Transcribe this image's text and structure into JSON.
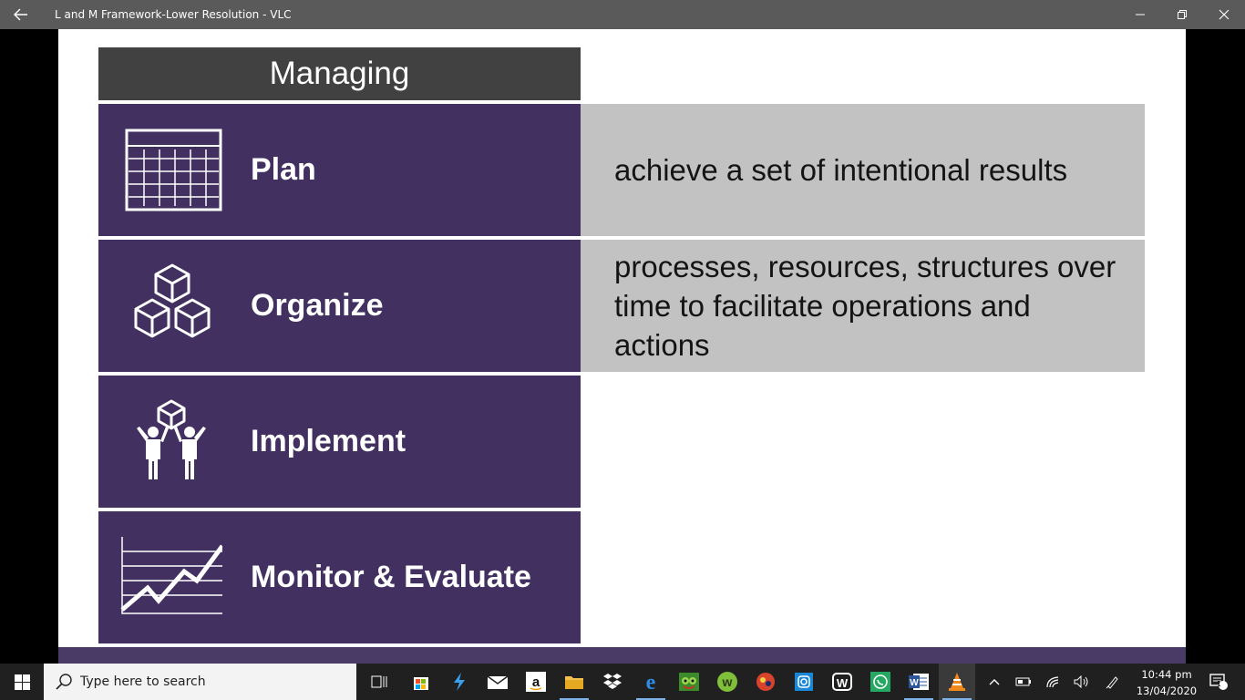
{
  "window": {
    "title": "L and M Framework-Lower Resolution - VLC"
  },
  "slide": {
    "header": "Managing",
    "rows": [
      {
        "label": "Plan",
        "icon": "calendar-grid-icon",
        "description": "achieve a set of intentional results"
      },
      {
        "label": "Organize",
        "icon": "stacked-cubes-icon",
        "description": "processes, resources, structures over time to facilitate operations and actions"
      },
      {
        "label": "Implement",
        "icon": "people-lifting-cube-icon",
        "description": ""
      },
      {
        "label": "Monitor & Evaluate",
        "icon": "trend-chart-icon",
        "description": ""
      }
    ],
    "colors": {
      "header_bg": "#414141",
      "row_bg": "#413060",
      "desc_bg": "#c2c2c2"
    }
  },
  "taskbar": {
    "search_placeholder": "Type here to search",
    "apps": [
      "task-view",
      "microsoft-store",
      "vscode",
      "mail",
      "amazon",
      "file-explorer",
      "dropbox",
      "edge",
      "game",
      "w-app",
      "game-2",
      "instagram",
      "wordament",
      "whatsapp",
      "word",
      "vlc"
    ],
    "clock_time": "10:44 pm",
    "clock_date": "13/04/2020",
    "notifications_count": "1"
  }
}
